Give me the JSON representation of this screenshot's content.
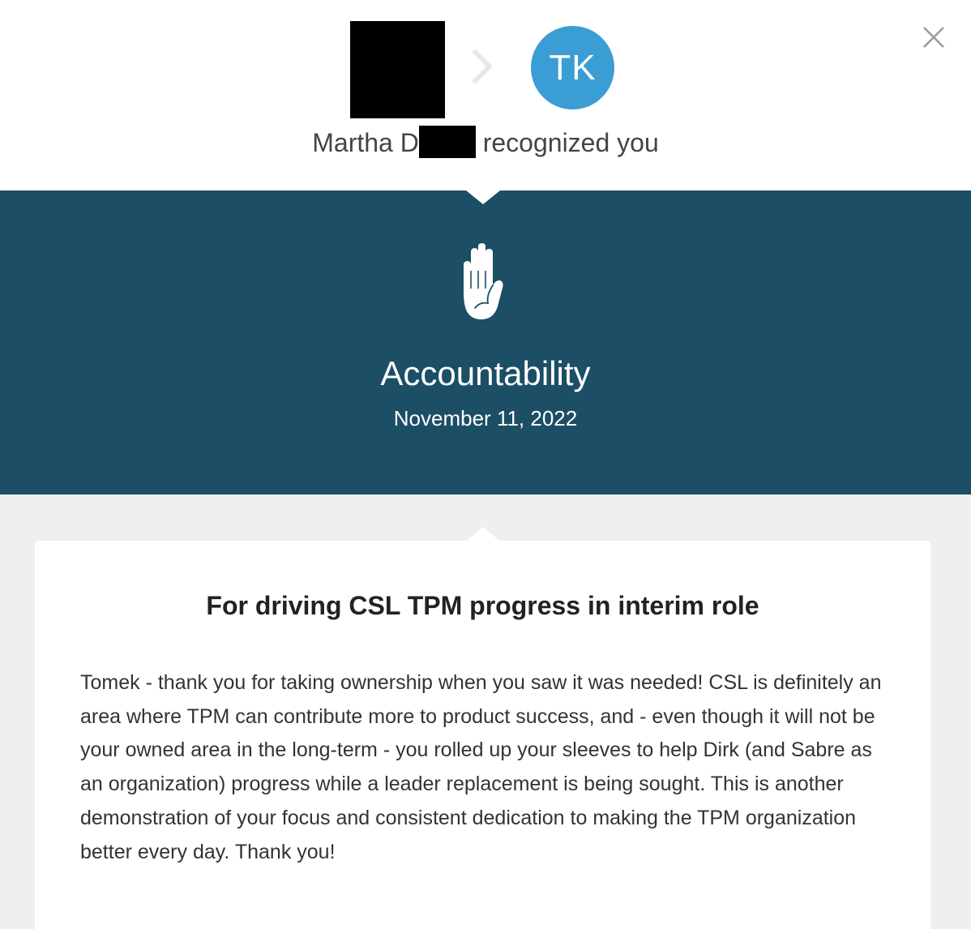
{
  "header": {
    "sender_name": "Martha D",
    "recognized_text": "recognized you",
    "recipient_initials": "TK",
    "close_icon": "close-icon",
    "arrow_icon": "chevron-right-icon"
  },
  "banner": {
    "icon": "raised-hand-icon",
    "value_title": "Accountability",
    "date": "November 11, 2022"
  },
  "card": {
    "title": "For driving CSL TPM progress in interim role",
    "message": "Tomek - thank you for taking ownership when you saw it was needed! CSL is definitely an area where TPM can contribute more to product success, and - even though it will not be your owned area in the long-term - you rolled up your sleeves to help Dirk (and Sabre as an organization) progress while a leader replacement is being sought. This is another demonstration of your focus and consistent dedication to making the TPM organization better every day. Thank you!"
  },
  "colors": {
    "banner_bg": "#1c4e65",
    "avatar_bg": "#3a9dd3",
    "page_bg": "#efefef"
  }
}
